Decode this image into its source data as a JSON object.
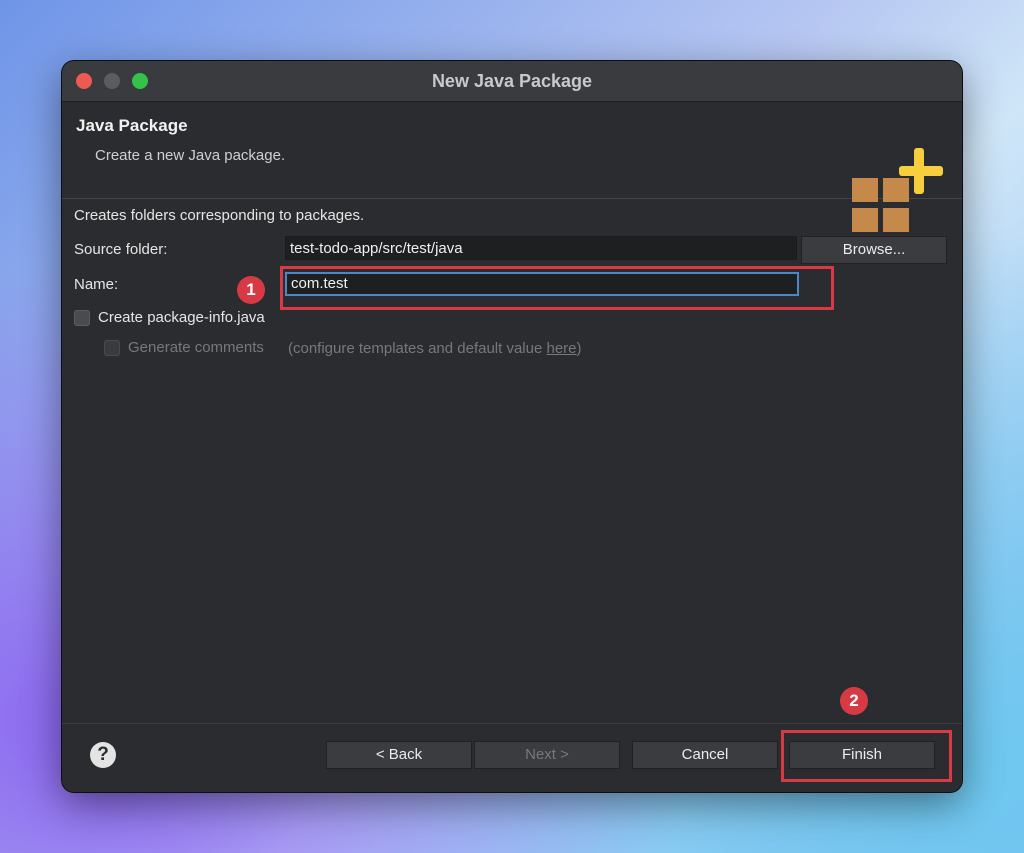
{
  "window": {
    "title": "New Java Package"
  },
  "header": {
    "title": "Java Package",
    "subtitle": "Create a new Java package."
  },
  "form": {
    "description": "Creates folders corresponding to packages.",
    "source_folder": {
      "label": "Source folder:",
      "value": "test-todo-app/src/test/java",
      "browse_label": "Browse..."
    },
    "name": {
      "label": "Name:",
      "value": "com.test"
    },
    "create_package_info": {
      "label": "Create package-info.java",
      "checked": false
    },
    "generate_comments": {
      "label": "Generate comments",
      "checked": false,
      "enabled": false,
      "hint_prefix": "(configure templates and default value ",
      "hint_link": "here",
      "hint_suffix": ")"
    }
  },
  "footer": {
    "help_symbol": "?",
    "back_label": "< Back",
    "next_label": "Next >",
    "cancel_label": "Cancel",
    "finish_label": "Finish"
  },
  "annotations": {
    "badge1": "1",
    "badge2": "2",
    "color": "#d83a45"
  },
  "icons": {
    "package": "new-package-icon",
    "help": "help-icon"
  },
  "colors": {
    "window_bg": "#2b2c2f",
    "focus_border": "#4a86c8",
    "annotation": "#d83a45",
    "package_brown": "#c58a4b",
    "plus_yellow": "#f7cf3e"
  }
}
